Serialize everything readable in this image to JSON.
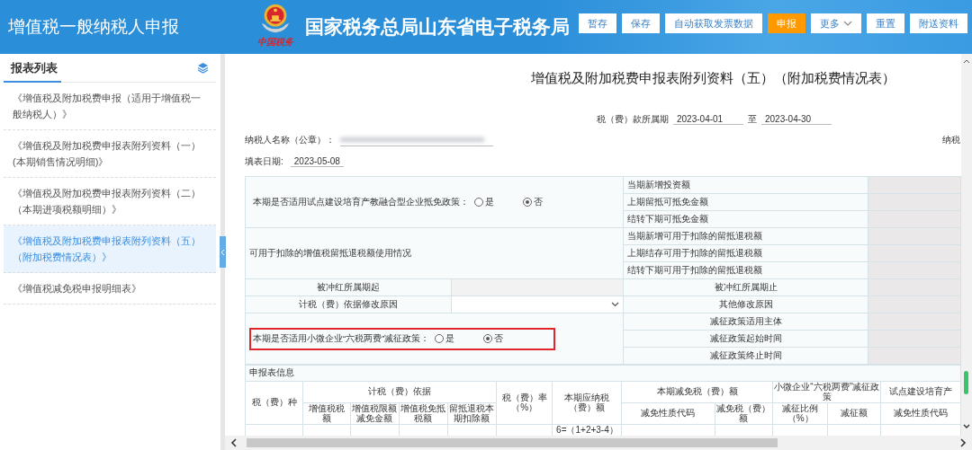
{
  "header": {
    "title": "增值税一般纳税人申报",
    "logo_caption": "中国税务",
    "site_name": "国家税务总局山东省电子税务局",
    "buttons": [
      {
        "label": "暂存",
        "kind": "plain"
      },
      {
        "label": "保存",
        "kind": "plain"
      },
      {
        "label": "自动获取发票数据",
        "kind": "plain"
      },
      {
        "label": "申报",
        "kind": "primary"
      },
      {
        "label": "更多",
        "kind": "dropdown"
      },
      {
        "label": "重置",
        "kind": "plain"
      },
      {
        "label": "附送资料",
        "kind": "plain"
      }
    ]
  },
  "sidebar": {
    "title": "报表列表",
    "items": [
      {
        "label": "《增值税及附加税费申报（适用于增值税一般纳税人）》",
        "selected": false
      },
      {
        "label": "《增值税及附加税费申报表附列资料（一）(本期销售情况明细)》",
        "selected": false
      },
      {
        "label": "《增值税及附加税费申报表附列资料（二）（本期进项税额明细）》",
        "selected": false
      },
      {
        "label": "《增值税及附加税费申报表附列资料（五）（附加税费情况表）》",
        "selected": true
      },
      {
        "label": "《增值税减免税申报明细表》",
        "selected": false
      }
    ]
  },
  "form": {
    "title": "增值税及附加税费申报表附列资料（五）（附加税费情况表）",
    "period_label": "税（费）款所属期",
    "period_start": "2023-04-01",
    "period_to": "至",
    "period_end": "2023-04-30",
    "taxpayer_label": "纳税人名称（公章）：",
    "taxpayer_right_label": "纳税",
    "fill_date_label": "填表日期:",
    "fill_date": "2023-05-08",
    "sections": [
      {
        "kind": "radio_group",
        "question": "本期是否适用试点建设培育产教融合型企业抵免政策：",
        "highlighted": false,
        "options": [
          {
            "label": "是",
            "selected": false
          },
          {
            "label": "否",
            "selected": true
          }
        ],
        "fields": [
          "当期新增投资额",
          "上期留抵可抵免金额",
          "结转下期可抵免金额"
        ]
      },
      {
        "kind": "text",
        "label": "可用于扣除的增值税留抵退税额使用情况",
        "fields": [
          "当期新增可用于扣除的留抵退税额",
          "上期结存可用于扣除的留抵退税额",
          "结转下期可用于扣除的留抵退税额"
        ]
      },
      {
        "kind": "input_pair",
        "left_label": "被冲红所属期起",
        "right_label": "被冲红所属期止"
      },
      {
        "kind": "select_pair",
        "left_label": "计税（费）依据修改原因",
        "right_label": "其他修改原因"
      },
      {
        "kind": "radio_group",
        "question": "本期是否适用小微企业“六税两费”减征政策：",
        "highlighted": true,
        "options": [
          {
            "label": "是",
            "selected": false
          },
          {
            "label": "否",
            "selected": true
          }
        ],
        "fields": [
          "减征政策适用主体",
          "减征政策起始时间",
          "减征政策终止时间"
        ]
      }
    ],
    "info_title": "申报表信息",
    "detail_header": [
      [
        {
          "text": "税（费）种",
          "rowspan": 2
        },
        {
          "text": "计税（费）依据",
          "colspan": 4
        },
        {
          "text": "税（费）率（%）",
          "rowspan": 2
        },
        {
          "text": "本期应纳税（费）额",
          "rowspan": 2,
          "formula": "6=（1+2+3-4）"
        },
        {
          "text": "本期减免税（费）额",
          "colspan": 2
        },
        {
          "text": "小微企业“六税两费”减征政策",
          "colspan": 2
        },
        {
          "text": "试点建设培育产"
        }
      ],
      [
        {
          "text": "增值税税额"
        },
        {
          "text": "增值税限额减免金额"
        },
        {
          "text": "增值税免抵税额"
        },
        {
          "text": "留抵退税本期扣除额"
        },
        {
          "text": "减免性质代码"
        },
        {
          "text": "减免税（费）额"
        },
        {
          "text": "减征比例（%）"
        },
        {
          "text": "减征额"
        },
        {
          "text": "减免性质代码"
        }
      ]
    ]
  }
}
